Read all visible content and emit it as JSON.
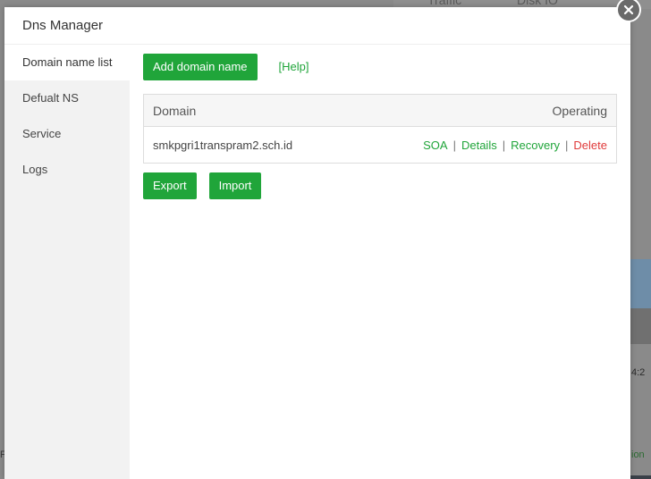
{
  "background": {
    "top_labels": [
      "Traffic",
      "Disk IO"
    ],
    "axis_label": "4:2",
    "left_text": "F",
    "right_text": "ion"
  },
  "modal": {
    "title": "Dns Manager"
  },
  "sidebar": {
    "items": [
      {
        "label": "Domain name list",
        "active": true
      },
      {
        "label": "Defualt NS"
      },
      {
        "label": "Service"
      },
      {
        "label": "Logs"
      }
    ]
  },
  "toolbar": {
    "add_label": "Add domain name",
    "help_label": "[Help]"
  },
  "table": {
    "headers": {
      "domain": "Domain",
      "operating": "Operating"
    },
    "rows": [
      {
        "domain": "smkpgri1transpram2.sch.id",
        "ops": {
          "soa": "SOA",
          "details": "Details",
          "recovery": "Recovery",
          "delete": "Delete"
        },
        "separator": "|"
      }
    ]
  },
  "actions": {
    "export_label": "Export",
    "import_label": "Import"
  },
  "colors": {
    "accent": "#20a53a",
    "danger": "#e03a3a"
  }
}
